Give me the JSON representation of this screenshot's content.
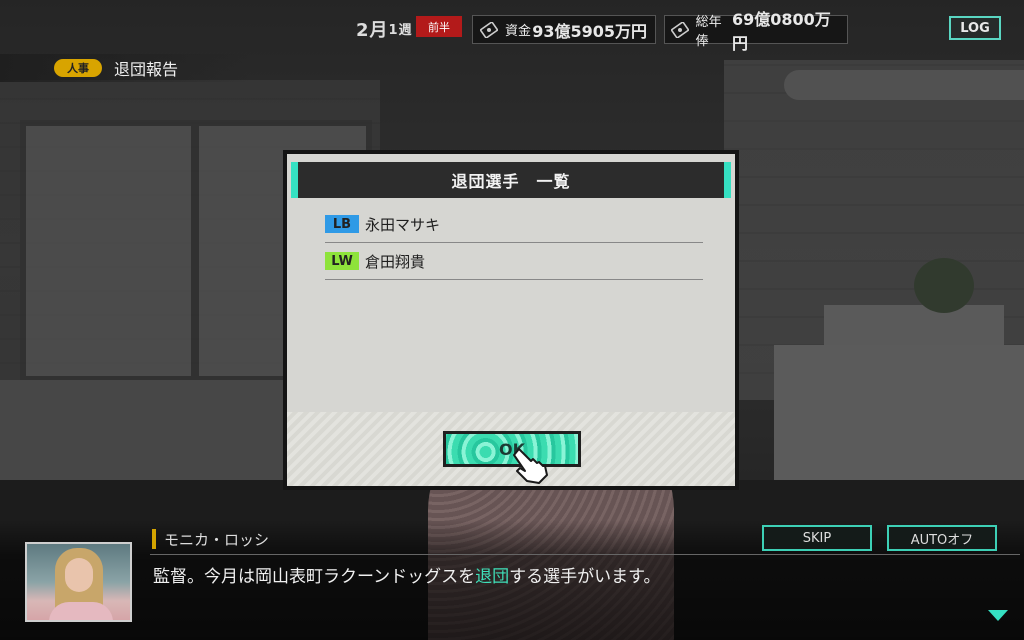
{
  "hud": {
    "date_month": "2月",
    "date_week": "1週",
    "half": "前半",
    "funds_label": "資金",
    "funds_value": "93億5905万円",
    "salary_label": "総年俸",
    "salary_value": "69億0800万円",
    "log_label": "LOG"
  },
  "category": {
    "badge": "人事",
    "title": "退団報告"
  },
  "dialog": {
    "title": "退団選手　一覧",
    "players": [
      {
        "position": "LB",
        "name": "永田マサキ",
        "color": "#2f9ae6"
      },
      {
        "position": "LW",
        "name": "倉田翔貴",
        "color": "#8ee33b"
      }
    ],
    "ok_label": "OK"
  },
  "message": {
    "speaker": "モニカ・ロッシ",
    "text_before": "監督。今月は岡山表町ラクーンドッグスを",
    "text_highlight": "退団",
    "text_after": "する選手がいます。"
  },
  "controls": {
    "skip_label": "SKIP",
    "auto_label": "AUTOオフ"
  },
  "icons": {
    "funds": "banknote-icon",
    "salary": "banknote-icon",
    "cursor": "pointing-hand-icon",
    "advance": "triangle-down-icon"
  },
  "colors": {
    "accent": "#35e0c2",
    "half_badge": "#b31a1a",
    "category_badge": "#d8a400",
    "highlight": "#3fe0b9"
  }
}
